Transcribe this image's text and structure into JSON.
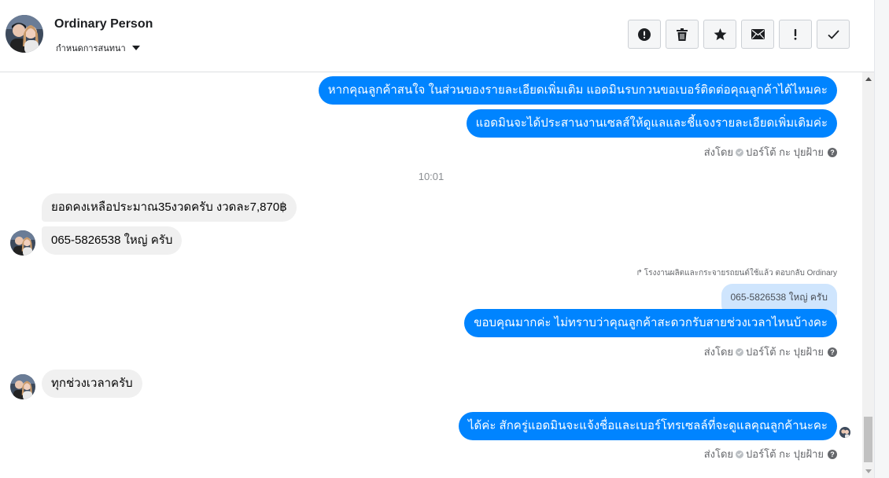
{
  "header": {
    "contact_name": "Ordinary Person",
    "conversation_menu_label": "กำหนดการสนทนา",
    "toolbar": [
      {
        "name": "report-button",
        "icon": "alert-circle-icon"
      },
      {
        "name": "delete-button",
        "icon": "trash-icon"
      },
      {
        "name": "star-button",
        "icon": "star-icon"
      },
      {
        "name": "mark-unread-button",
        "icon": "envelope-icon"
      },
      {
        "name": "important-button",
        "icon": "exclamation-icon"
      },
      {
        "name": "mark-done-button",
        "icon": "checkmark-icon"
      }
    ]
  },
  "messages": {
    "out1": "หากคุณลูกค้าสนใจ ในส่วนของรายละเอียดเพิ่มเติม แอดมินรบกวนขอเบอร์ติดต่อคุณลูกค้าได้ไหมคะ",
    "out2": "แอดมินจะได้ประสานงานเซลส์ให้ดูแลและชี้แจงรายละเอียดเพิ่มเติมค่ะ",
    "sent_by_1": "ส่งโดย",
    "sender_1": "ปอร์โต้ กะ ปุยฝ้าย",
    "time_1": "10:01",
    "in1": "ยอดคงเหลือประมาณ35งวดครับ งวดละ7,870฿",
    "in2": "065-5826538 ใหญ่ ครับ",
    "reply_note": "โรงงานผลิตและกระจายรถยนต์ใช้แล้ว ตอบกลับ Ordinary",
    "quoted": "065-5826538 ใหญ่ ครับ",
    "out3": "ขอบคุณมากค่ะ ไม่ทราบว่าคุณลูกค้าสะดวกรับสายช่วงเวลาไหนบ้างคะ",
    "sent_by_2": "ส่งโดย",
    "sender_2": "ปอร์โต้ กะ ปุยฝ้าย",
    "in3": "ทุกช่วงเวลาครับ",
    "out4": "ได้ค่ะ สักครู่แอดมินจะแจ้งชื่อและเบอร์โทรเซลล์ที่จะดูแลคุณลูกค้านะคะ",
    "sent_by_3": "ส่งโดย",
    "sender_3": "ปอร์โต้ กะ ปุยฝ้าย"
  },
  "colors": {
    "outgoing_bubble": "#0084ff",
    "incoming_bubble": "#f0f0f0",
    "quoted_bubble": "#cfe5fd"
  }
}
